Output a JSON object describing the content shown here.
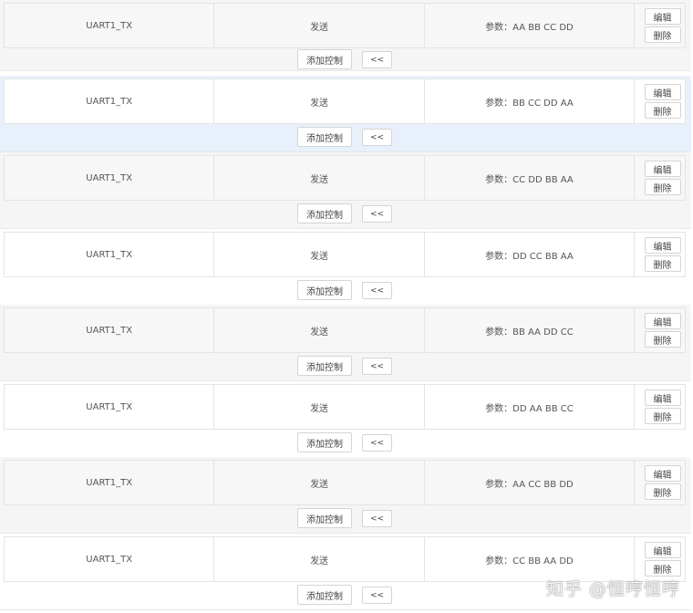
{
  "rows": [
    {
      "signal": "UART1_TX",
      "action": "发送",
      "params": "参数：AA BB CC DD",
      "edit_label": "编辑",
      "delete_label": "删除",
      "add_label": "添加控制",
      "collapse_label": "<<"
    },
    {
      "signal": "UART1_TX",
      "action": "发送",
      "params": "参数：BB CC DD AA",
      "edit_label": "编辑",
      "delete_label": "删除",
      "add_label": "添加控制",
      "collapse_label": "<<"
    },
    {
      "signal": "UART1_TX",
      "action": "发送",
      "params": "参数：CC DD BB AA",
      "edit_label": "编辑",
      "delete_label": "删除",
      "add_label": "添加控制",
      "collapse_label": "<<"
    },
    {
      "signal": "UART1_TX",
      "action": "发送",
      "params": "参数：DD CC BB AA",
      "edit_label": "编辑",
      "delete_label": "删除",
      "add_label": "添加控制",
      "collapse_label": "<<"
    },
    {
      "signal": "UART1_TX",
      "action": "发送",
      "params": "参数：BB AA DD CC",
      "edit_label": "编辑",
      "delete_label": "删除",
      "add_label": "添加控制",
      "collapse_label": "<<"
    },
    {
      "signal": "UART1_TX",
      "action": "发送",
      "params": "参数：DD AA BB CC",
      "edit_label": "编辑",
      "delete_label": "删除",
      "add_label": "添加控制",
      "collapse_label": "<<"
    },
    {
      "signal": "UART1_TX",
      "action": "发送",
      "params": "参数：AA CC BB DD",
      "edit_label": "编辑",
      "delete_label": "删除",
      "add_label": "添加控制",
      "collapse_label": "<<"
    },
    {
      "signal": "UART1_TX",
      "action": "发送",
      "params": "参数：CC BB AA DD",
      "edit_label": "编辑",
      "delete_label": "删除",
      "add_label": "添加控制",
      "collapse_label": "<<"
    }
  ],
  "watermark": "知乎 @恒哼恒哼",
  "colors": {
    "row_alt_bg": "#f5f5f5",
    "row_highlight_bg": "#e8f1fb",
    "border": "#e4e4e4"
  }
}
